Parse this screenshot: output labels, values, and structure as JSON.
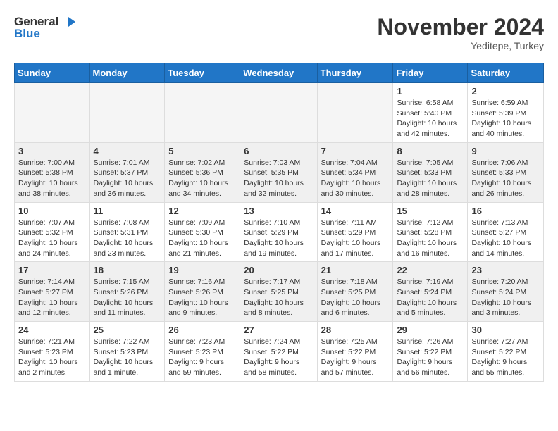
{
  "logo": {
    "line1": "General",
    "line2": "Blue"
  },
  "title": "November 2024",
  "location": "Yeditepe, Turkey",
  "weekdays": [
    "Sunday",
    "Monday",
    "Tuesday",
    "Wednesday",
    "Thursday",
    "Friday",
    "Saturday"
  ],
  "weeks": [
    [
      {
        "day": "",
        "info": ""
      },
      {
        "day": "",
        "info": ""
      },
      {
        "day": "",
        "info": ""
      },
      {
        "day": "",
        "info": ""
      },
      {
        "day": "",
        "info": ""
      },
      {
        "day": "1",
        "info": "Sunrise: 6:58 AM\nSunset: 5:40 PM\nDaylight: 10 hours and 42 minutes."
      },
      {
        "day": "2",
        "info": "Sunrise: 6:59 AM\nSunset: 5:39 PM\nDaylight: 10 hours and 40 minutes."
      }
    ],
    [
      {
        "day": "3",
        "info": "Sunrise: 7:00 AM\nSunset: 5:38 PM\nDaylight: 10 hours and 38 minutes."
      },
      {
        "day": "4",
        "info": "Sunrise: 7:01 AM\nSunset: 5:37 PM\nDaylight: 10 hours and 36 minutes."
      },
      {
        "day": "5",
        "info": "Sunrise: 7:02 AM\nSunset: 5:36 PM\nDaylight: 10 hours and 34 minutes."
      },
      {
        "day": "6",
        "info": "Sunrise: 7:03 AM\nSunset: 5:35 PM\nDaylight: 10 hours and 32 minutes."
      },
      {
        "day": "7",
        "info": "Sunrise: 7:04 AM\nSunset: 5:34 PM\nDaylight: 10 hours and 30 minutes."
      },
      {
        "day": "8",
        "info": "Sunrise: 7:05 AM\nSunset: 5:33 PM\nDaylight: 10 hours and 28 minutes."
      },
      {
        "day": "9",
        "info": "Sunrise: 7:06 AM\nSunset: 5:33 PM\nDaylight: 10 hours and 26 minutes."
      }
    ],
    [
      {
        "day": "10",
        "info": "Sunrise: 7:07 AM\nSunset: 5:32 PM\nDaylight: 10 hours and 24 minutes."
      },
      {
        "day": "11",
        "info": "Sunrise: 7:08 AM\nSunset: 5:31 PM\nDaylight: 10 hours and 23 minutes."
      },
      {
        "day": "12",
        "info": "Sunrise: 7:09 AM\nSunset: 5:30 PM\nDaylight: 10 hours and 21 minutes."
      },
      {
        "day": "13",
        "info": "Sunrise: 7:10 AM\nSunset: 5:29 PM\nDaylight: 10 hours and 19 minutes."
      },
      {
        "day": "14",
        "info": "Sunrise: 7:11 AM\nSunset: 5:29 PM\nDaylight: 10 hours and 17 minutes."
      },
      {
        "day": "15",
        "info": "Sunrise: 7:12 AM\nSunset: 5:28 PM\nDaylight: 10 hours and 16 minutes."
      },
      {
        "day": "16",
        "info": "Sunrise: 7:13 AM\nSunset: 5:27 PM\nDaylight: 10 hours and 14 minutes."
      }
    ],
    [
      {
        "day": "17",
        "info": "Sunrise: 7:14 AM\nSunset: 5:27 PM\nDaylight: 10 hours and 12 minutes."
      },
      {
        "day": "18",
        "info": "Sunrise: 7:15 AM\nSunset: 5:26 PM\nDaylight: 10 hours and 11 minutes."
      },
      {
        "day": "19",
        "info": "Sunrise: 7:16 AM\nSunset: 5:26 PM\nDaylight: 10 hours and 9 minutes."
      },
      {
        "day": "20",
        "info": "Sunrise: 7:17 AM\nSunset: 5:25 PM\nDaylight: 10 hours and 8 minutes."
      },
      {
        "day": "21",
        "info": "Sunrise: 7:18 AM\nSunset: 5:25 PM\nDaylight: 10 hours and 6 minutes."
      },
      {
        "day": "22",
        "info": "Sunrise: 7:19 AM\nSunset: 5:24 PM\nDaylight: 10 hours and 5 minutes."
      },
      {
        "day": "23",
        "info": "Sunrise: 7:20 AM\nSunset: 5:24 PM\nDaylight: 10 hours and 3 minutes."
      }
    ],
    [
      {
        "day": "24",
        "info": "Sunrise: 7:21 AM\nSunset: 5:23 PM\nDaylight: 10 hours and 2 minutes."
      },
      {
        "day": "25",
        "info": "Sunrise: 7:22 AM\nSunset: 5:23 PM\nDaylight: 10 hours and 1 minute."
      },
      {
        "day": "26",
        "info": "Sunrise: 7:23 AM\nSunset: 5:23 PM\nDaylight: 9 hours and 59 minutes."
      },
      {
        "day": "27",
        "info": "Sunrise: 7:24 AM\nSunset: 5:22 PM\nDaylight: 9 hours and 58 minutes."
      },
      {
        "day": "28",
        "info": "Sunrise: 7:25 AM\nSunset: 5:22 PM\nDaylight: 9 hours and 57 minutes."
      },
      {
        "day": "29",
        "info": "Sunrise: 7:26 AM\nSunset: 5:22 PM\nDaylight: 9 hours and 56 minutes."
      },
      {
        "day": "30",
        "info": "Sunrise: 7:27 AM\nSunset: 5:22 PM\nDaylight: 9 hours and 55 minutes."
      }
    ]
  ]
}
